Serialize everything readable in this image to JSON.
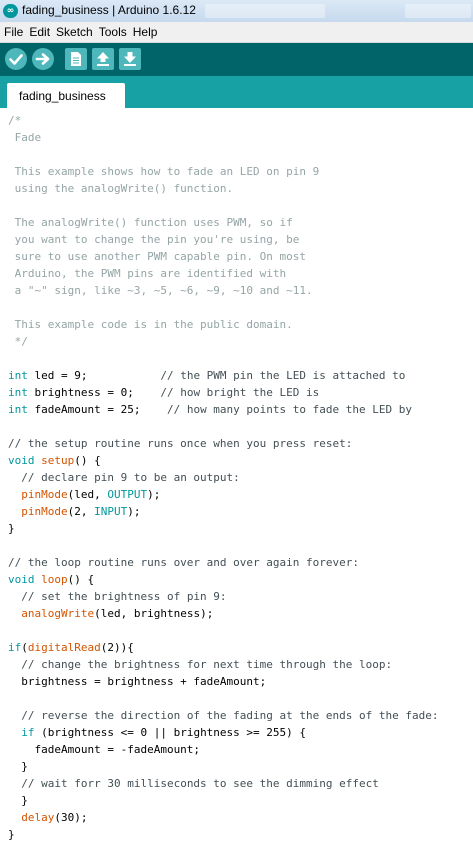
{
  "window": {
    "title": "fading_business | Arduino 1.6.12",
    "logo_glyph": "∞"
  },
  "menu": [
    "File",
    "Edit",
    "Sketch",
    "Tools",
    "Help"
  ],
  "toolbar": {
    "buttons": [
      "verify-icon",
      "upload-icon",
      "new-icon",
      "open-icon",
      "save-icon"
    ],
    "accent": "#006468"
  },
  "tabs": [
    "fading_business"
  ],
  "colors": {
    "comment_block": "#95a5a6",
    "comment_line": "#434f54",
    "keyword": "#00979c",
    "function": "#d35400"
  },
  "code_lines": [
    [
      [
        "com",
        "/*"
      ]
    ],
    [
      [
        "com",
        " Fade"
      ]
    ],
    [],
    [
      [
        "com",
        " This example shows how to fade an LED on pin 9"
      ]
    ],
    [
      [
        "com",
        " using the analogWrite() function."
      ]
    ],
    [],
    [
      [
        "com",
        " The analogWrite() function uses PWM, so if"
      ]
    ],
    [
      [
        "com",
        " you want to change the pin you're using, be"
      ]
    ],
    [
      [
        "com",
        " sure to use another PWM capable pin. On most"
      ]
    ],
    [
      [
        "com",
        " Arduino, the PWM pins are identified with"
      ]
    ],
    [
      [
        "com",
        " a \"~\" sign, like ~3, ~5, ~6, ~9, ~10 and ~11."
      ]
    ],
    [],
    [
      [
        "com",
        " This example code is in the public domain."
      ]
    ],
    [
      [
        "com",
        " */"
      ]
    ],
    [],
    [
      [
        "kw",
        "int"
      ],
      [
        "txt",
        " led = 9;           "
      ],
      [
        "cmt",
        "// the PWM pin the LED is attached to"
      ]
    ],
    [
      [
        "kw",
        "int"
      ],
      [
        "txt",
        " brightness = 0;    "
      ],
      [
        "cmt",
        "// how bright the LED is"
      ]
    ],
    [
      [
        "kw",
        "int"
      ],
      [
        "txt",
        " fadeAmount = 25;    "
      ],
      [
        "cmt",
        "// how many points to fade the LED by"
      ]
    ],
    [],
    [
      [
        "cmt",
        "// the setup routine runs once when you press reset:"
      ]
    ],
    [
      [
        "kw",
        "void"
      ],
      [
        "txt",
        " "
      ],
      [
        "fn",
        "setup"
      ],
      [
        "txt",
        "() {"
      ]
    ],
    [
      [
        "txt",
        "  "
      ],
      [
        "cmt",
        "// declare pin 9 to be an output:"
      ]
    ],
    [
      [
        "txt",
        "  "
      ],
      [
        "fn",
        "pinMode"
      ],
      [
        "txt",
        "(led, "
      ],
      [
        "kw",
        "OUTPUT"
      ],
      [
        "txt",
        ");"
      ]
    ],
    [
      [
        "txt",
        "  "
      ],
      [
        "fn",
        "pinMode"
      ],
      [
        "txt",
        "(2, "
      ],
      [
        "kw",
        "INPUT"
      ],
      [
        "txt",
        ");"
      ]
    ],
    [
      [
        "txt",
        "}"
      ]
    ],
    [],
    [
      [
        "cmt",
        "// the loop routine runs over and over again forever:"
      ]
    ],
    [
      [
        "kw",
        "void"
      ],
      [
        "txt",
        " "
      ],
      [
        "fn",
        "loop"
      ],
      [
        "txt",
        "() {"
      ]
    ],
    [
      [
        "txt",
        "  "
      ],
      [
        "cmt",
        "// set the brightness of pin 9:"
      ]
    ],
    [
      [
        "txt",
        "  "
      ],
      [
        "fn",
        "analogWrite"
      ],
      [
        "txt",
        "(led, brightness);"
      ]
    ],
    [],
    [
      [
        "kw",
        "if"
      ],
      [
        "txt",
        "("
      ],
      [
        "fn",
        "digitalRead"
      ],
      [
        "txt",
        "(2)){"
      ]
    ],
    [
      [
        "txt",
        "  "
      ],
      [
        "cmt",
        "// change the brightness for next time through the loop:"
      ]
    ],
    [
      [
        "txt",
        "  brightness = brightness + fadeAmount;"
      ]
    ],
    [],
    [
      [
        "txt",
        "  "
      ],
      [
        "cmt",
        "// reverse the direction of the fading at the ends of the fade:"
      ]
    ],
    [
      [
        "txt",
        "  "
      ],
      [
        "kw",
        "if"
      ],
      [
        "txt",
        " (brightness <= 0 || brightness >= 255) {"
      ]
    ],
    [
      [
        "txt",
        "    fadeAmount = -fadeAmount;"
      ]
    ],
    [
      [
        "txt",
        "  }"
      ]
    ],
    [
      [
        "txt",
        "  "
      ],
      [
        "cmt",
        "// wait forr 30 milliseconds to see the dimming effect"
      ]
    ],
    [
      [
        "txt",
        "  }"
      ]
    ],
    [
      [
        "txt",
        "  "
      ],
      [
        "fn",
        "delay"
      ],
      [
        "txt",
        "(30);"
      ]
    ],
    [
      [
        "txt",
        "}"
      ]
    ]
  ]
}
